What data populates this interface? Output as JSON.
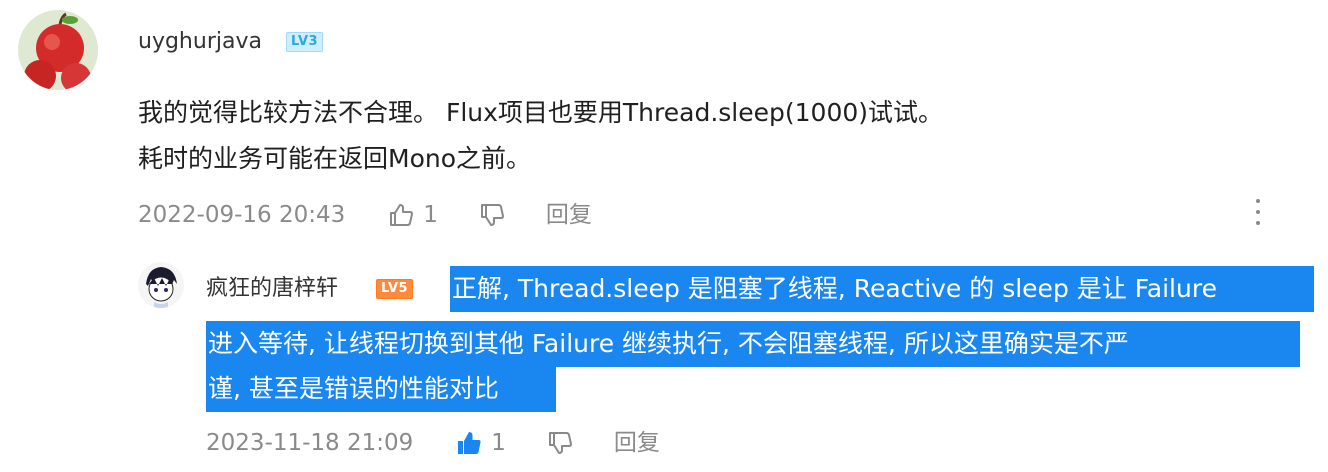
{
  "comment": {
    "username": "uyghurjava",
    "level": "LV3",
    "lines": [
      "我的觉得比较方法不合理。 Flux项目也要用Thread.sleep(1000)试试。",
      "耗时的业务可能在返回Mono之前。"
    ],
    "timestamp": "2022-09-16 20:43",
    "like_count": "1",
    "reply_label": "回复"
  },
  "reply": {
    "username": "疯狂的唐梓轩",
    "level": "LV5",
    "lines": [
      "正解, Thread.sleep 是阻塞了线程, Reactive 的 sleep 是让 Failure",
      "进入等待, 让线程切换到其他 Failure 继续执行, 不会阻塞线程, 所以这里确实是不严",
      "谨, 甚至是错误的性能对比"
    ],
    "timestamp": "2023-11-18 21:09",
    "like_count": "1",
    "reply_label": "回复"
  },
  "colors": {
    "selection": "#1a86f0",
    "like_active": "#1a86f0",
    "meta_text": "#8a8a8a",
    "level3": "#2ea8de",
    "level5": "#ff8a3c"
  }
}
